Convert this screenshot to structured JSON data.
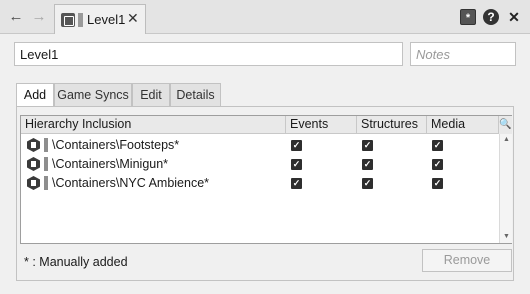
{
  "titlebar": {
    "back_icon": "back-arrow-icon",
    "forward_icon": "forward-arrow-icon",
    "tab_title": "Level1",
    "tab_close_glyph": "✕",
    "pin_glyph": "*",
    "help_glyph": "?",
    "close_glyph": "✕"
  },
  "form": {
    "name_value": "Level1",
    "notes_placeholder": "Notes"
  },
  "tabs": [
    "Add",
    "Game Syncs",
    "Edit",
    "Details"
  ],
  "table": {
    "columns": [
      "Hierarchy Inclusion",
      "Events",
      "Structures",
      "Media"
    ],
    "rows": [
      {
        "path": "\\Containers\\Footsteps*",
        "events": true,
        "structures": true,
        "media": true
      },
      {
        "path": "\\Containers\\Minigun*",
        "events": true,
        "structures": true,
        "media": true
      },
      {
        "path": "\\Containers\\NYC Ambience*",
        "events": true,
        "structures": true,
        "media": true
      }
    ]
  },
  "footer": {
    "note": "* : Manually added",
    "remove_label": "Remove"
  },
  "colors": {
    "background": "#f0f0f0",
    "disabled_text": "#9a9a9a",
    "checkbox": "#2e2e2e"
  }
}
